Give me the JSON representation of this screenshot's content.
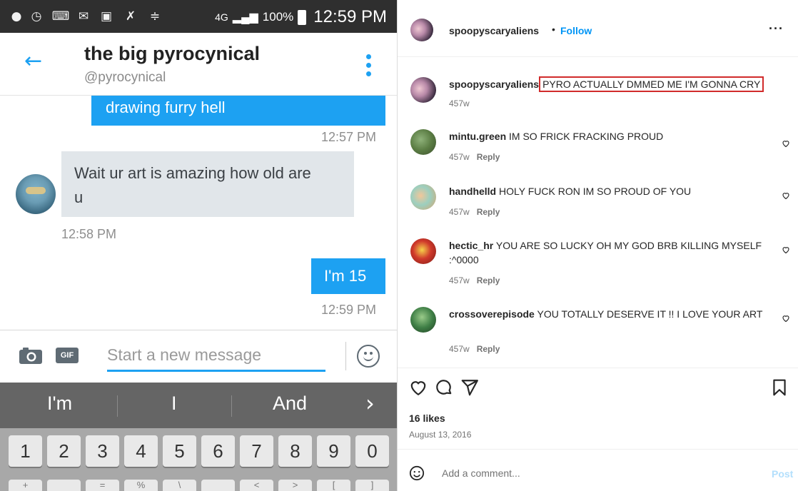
{
  "status_bar": {
    "battery": "100%",
    "time": "12:59 PM",
    "network": "4G"
  },
  "dm": {
    "name": "the big pyrocynical",
    "handle": "@pyrocynical",
    "messages": [
      {
        "direction": "out",
        "text": "drawing furry hell",
        "time": "12:57 PM"
      },
      {
        "direction": "in",
        "text_line1": "Wait ur art is amazing how old are",
        "text_line2": "u",
        "time": "12:58 PM"
      },
      {
        "direction": "out",
        "text": "I'm 15",
        "time": "12:59 PM"
      }
    ],
    "composer_placeholder": "Start a new message",
    "gif_label": "GIF"
  },
  "keyboard": {
    "suggestions": [
      "I'm",
      "I",
      "And"
    ],
    "number_keys": [
      "1",
      "2",
      "3",
      "4",
      "5",
      "6",
      "7",
      "8",
      "9",
      "0"
    ],
    "second_row_hints": [
      "+",
      "",
      "=",
      "%",
      "\\",
      "",
      "<",
      ">",
      "[",
      "]"
    ]
  },
  "instagram": {
    "post_author": "spoopyscaryaliens",
    "separator": "•",
    "follow_label": "Follow",
    "caption": {
      "user": "spoopyscaryaliens",
      "text": "PYRO ACTUALLY DMMED ME I'M GONNA CRY",
      "age": "457w"
    },
    "comments": [
      {
        "user": "mintu.green",
        "text": "IM SO FRICK FRACKING PROUD",
        "age": "457w",
        "reply": "Reply"
      },
      {
        "user": "handhelld",
        "text": "HOLY FUCK RON IM SO PROUD OF YOU",
        "age": "457w",
        "reply": "Reply"
      },
      {
        "user": "hectic_hr",
        "text": "YOU ARE SO LUCKY OH MY GOD BRB KILLING MYSELF :^0000",
        "age": "457w",
        "reply": "Reply"
      },
      {
        "user": "crossoverepisode",
        "text": "YOU TOTALLY DESERVE IT !! I LOVE YOUR ART",
        "age": "457w",
        "reply": "Reply"
      }
    ],
    "likes": "16 likes",
    "date": "August 13, 2016",
    "add_comment_placeholder": "Add a comment...",
    "post_label": "Post",
    "colors": {
      "link_blue": "#0095f6",
      "highlight_red": "#d12b2b",
      "twitter_blue": "#1da1f2"
    }
  }
}
